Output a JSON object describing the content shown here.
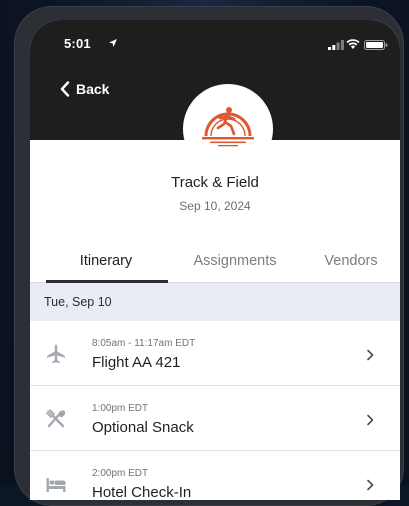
{
  "status_bar": {
    "time": "5:01",
    "icons": [
      "location-arrow-icon",
      "signal-icon",
      "wifi-icon",
      "battery-icon"
    ]
  },
  "nav": {
    "back_label": "Back"
  },
  "event": {
    "title": "Track & Field",
    "date": "Sep 10, 2024",
    "logo_icon": "runner-sunset-logo"
  },
  "tabs": [
    {
      "label": "Itinerary",
      "active": true
    },
    {
      "label": "Assignments",
      "active": false
    },
    {
      "label": "Vendors",
      "active": false
    }
  ],
  "day": {
    "label": "Tue, Sep 10"
  },
  "items": [
    {
      "time": "8:05am - 11:17am EDT",
      "title": "Flight AA 421",
      "icon": "airplane-icon"
    },
    {
      "time": "1:00pm EDT",
      "title": "Optional Snack",
      "icon": "utensils-icon"
    },
    {
      "time": "2:00pm EDT",
      "title": "Hotel Check-In",
      "icon": "bed-icon"
    }
  ],
  "colors": {
    "header_bg": "#1e1e1f",
    "accent": "#e0572f",
    "day_header_bg": "#e9ecf2",
    "icon_gray": "#a3a7ae"
  }
}
